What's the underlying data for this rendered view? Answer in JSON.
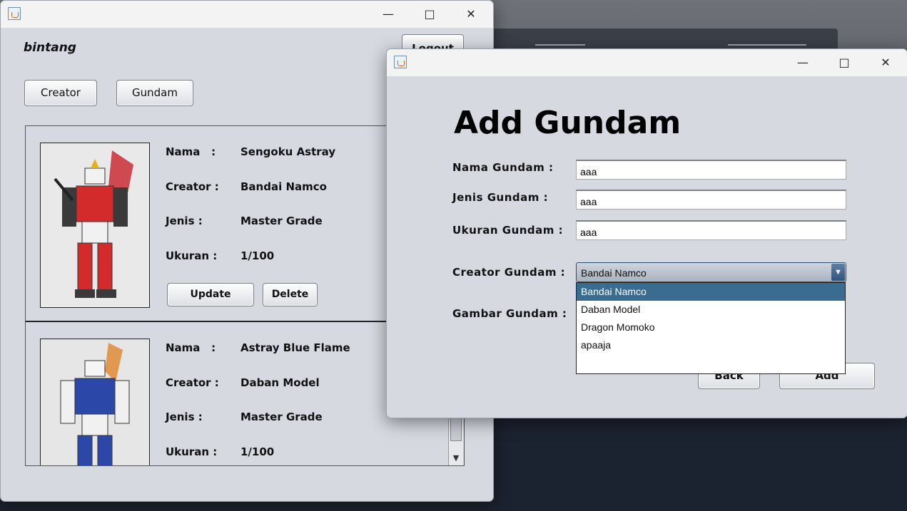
{
  "main_window": {
    "user_name": "bintang",
    "logout_label": "Logout",
    "nav": {
      "creator_label": "Creator",
      "gundam_label": "Gundam"
    },
    "labels": {
      "nama": "Nama",
      "creator": "Creator :",
      "jenis": "Jenis :",
      "ukuran": "Ukuran :",
      "colon": ":"
    },
    "cards": [
      {
        "nama": "Sengoku Astray",
        "creator": "Bandai Namco",
        "jenis": "Master Grade",
        "ukuran": "1/100",
        "update_label": "Update",
        "delete_label": "Delete",
        "image": "gundam-red-figure"
      },
      {
        "nama": "Astray Blue Flame",
        "creator": "Daban Model",
        "jenis": "Master Grade",
        "ukuran": "1/100",
        "image": "gundam-blue-figure"
      }
    ]
  },
  "dialog": {
    "title": "Add Gundam",
    "nama_label": "Nama Gundam :",
    "jenis_label": "Jenis Gundam :",
    "ukuran_label": "Ukuran Gundam :",
    "creator_label": "Creator Gundam :",
    "gambar_label": "Gambar Gundam :",
    "nama_value": "aaa",
    "jenis_value": "aaa",
    "ukuran_value": "aaa",
    "creator_selected": "Bandai Namco",
    "creator_options": [
      "Bandai Namco",
      "Daban Model",
      "Dragon Momoko",
      "apaaja"
    ],
    "back_label": "Back",
    "add_label": "Add"
  },
  "colors": {
    "selected_option": "#3a6b90",
    "window_bg": "#d6d9e0"
  }
}
